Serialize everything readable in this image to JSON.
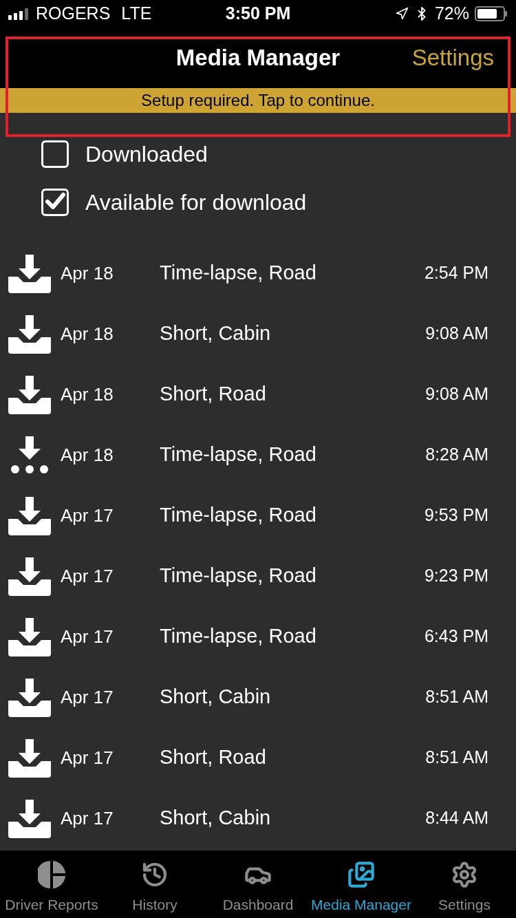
{
  "status_bar": {
    "carrier": "ROGERS",
    "network": "LTE",
    "time": "3:50 PM",
    "battery": "72%"
  },
  "nav": {
    "title": "Media Manager",
    "action": "Settings"
  },
  "banner": {
    "text": "Setup required. Tap to continue."
  },
  "filters": [
    {
      "label": "Downloaded",
      "checked": false
    },
    {
      "label": "Available for download",
      "checked": true
    }
  ],
  "media": [
    {
      "kind": "download",
      "date": "Apr 18",
      "type": "Time-lapse, Road",
      "time": "2:54 PM"
    },
    {
      "kind": "download",
      "date": "Apr 18",
      "type": "Short, Cabin",
      "time": "9:08 AM"
    },
    {
      "kind": "download",
      "date": "Apr 18",
      "type": "Short, Road",
      "time": "9:08 AM"
    },
    {
      "kind": "pending",
      "date": "Apr 18",
      "type": "Time-lapse, Road",
      "time": "8:28 AM"
    },
    {
      "kind": "download",
      "date": "Apr 17",
      "type": "Time-lapse, Road",
      "time": "9:53 PM"
    },
    {
      "kind": "download",
      "date": "Apr 17",
      "type": "Time-lapse, Road",
      "time": "9:23 PM"
    },
    {
      "kind": "download",
      "date": "Apr 17",
      "type": "Time-lapse, Road",
      "time": "6:43 PM"
    },
    {
      "kind": "download",
      "date": "Apr 17",
      "type": "Short, Cabin",
      "time": "8:51 AM"
    },
    {
      "kind": "download",
      "date": "Apr 17",
      "type": "Short, Road",
      "time": "8:51 AM"
    },
    {
      "kind": "download",
      "date": "Apr 17",
      "type": "Short, Cabin",
      "time": "8:44 AM"
    }
  ],
  "tab_bar": [
    {
      "kind": "reports",
      "label": "Driver Reports",
      "selected": false
    },
    {
      "kind": "history",
      "label": "History",
      "selected": false
    },
    {
      "kind": "car",
      "label": "Dashboard",
      "selected": false
    },
    {
      "kind": "media",
      "label": "Media Manager",
      "selected": true
    },
    {
      "kind": "settings",
      "label": "Settings",
      "selected": false
    }
  ]
}
